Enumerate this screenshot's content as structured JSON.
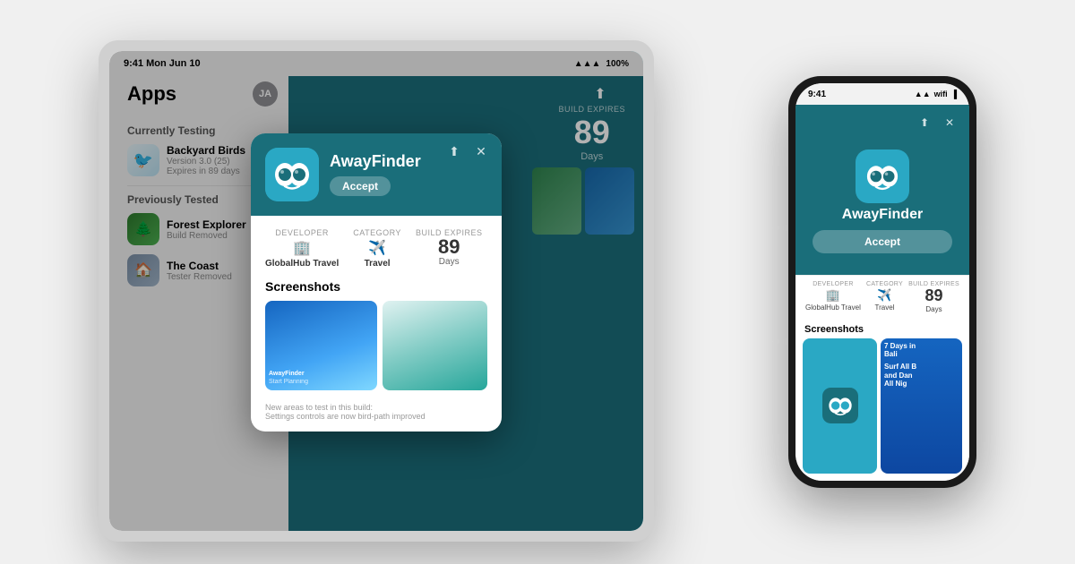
{
  "scene": {
    "background_color": "#f0f0f0"
  },
  "tablet": {
    "statusbar": {
      "time": "9:41 Mon Jun 10",
      "signal": "📶",
      "battery": "100%"
    },
    "sidebar": {
      "title": "Apps",
      "avatar": "JA",
      "sections": [
        {
          "label": "Currently Testing",
          "apps": [
            {
              "name": "Backyard Birds",
              "sub1": "Version 3.0 (25)",
              "sub2": "Expires in 89 days",
              "icon_type": "birds"
            }
          ]
        },
        {
          "label": "Previously Tested",
          "apps": [
            {
              "name": "Forest Explorer",
              "sub": "Build Removed",
              "icon_type": "forest"
            },
            {
              "name": "The Coast",
              "sub": "Tester Removed",
              "icon_type": "coast"
            }
          ]
        }
      ]
    },
    "main": {
      "build_expires_label": "BUILD EXPIRES",
      "build_expires_num": "89",
      "build_expires_unit": "Days"
    },
    "modal": {
      "app_name": "AwayFinder",
      "accept_label": "Accept",
      "developer_label": "DEVELOPER",
      "developer_value": "GlobalHub Travel",
      "category_label": "CATEGORY",
      "category_value": "Travel",
      "build_expires_label": "BUILD EXPIRES",
      "build_expires_num": "89",
      "build_expires_unit": "Days",
      "screenshots_label": "Screenshots",
      "footer_text": "New areas to test in this build:",
      "footer_sub": "Settings controls are now bird-path improved"
    }
  },
  "phone": {
    "statusbar": {
      "time": "9:41",
      "signal": "●●●",
      "wifi": "wifi",
      "battery": "🔋"
    },
    "modal": {
      "app_name": "AwayFinder",
      "accept_label": "Accept",
      "developer_label": "DEVELOPER",
      "developer_value": "GlobalHub Travel",
      "category_label": "CATEGORY",
      "category_value": "Travel",
      "build_expires_label": "BUILD EXPIRES",
      "build_expires_num": "89",
      "build_expires_unit": "Days",
      "screenshots_label": "Screenshots",
      "ss2_line1": "7 Days in",
      "ss2_line2": "Bali",
      "ss2_line3": "Surf All B",
      "ss2_line4": "and Dan",
      "ss2_line5": "All Nig"
    }
  }
}
